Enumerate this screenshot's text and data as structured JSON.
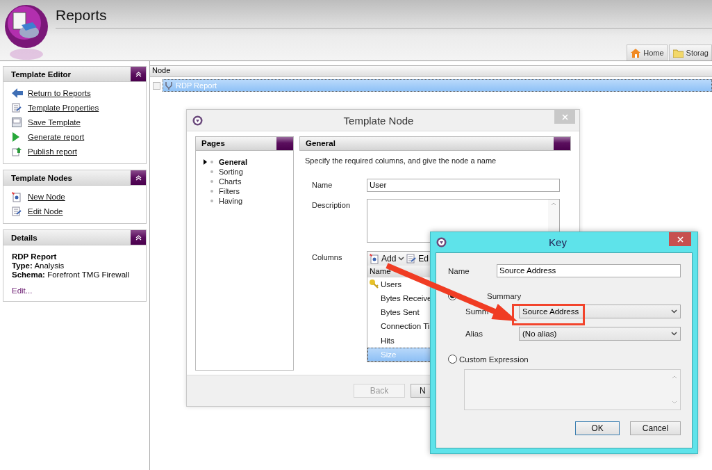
{
  "app": {
    "title": "Reports"
  },
  "nav_tabs": [
    {
      "label": "Home"
    },
    {
      "label": "Storag"
    }
  ],
  "sidebar": [
    {
      "title": "Template Editor",
      "kind": "links",
      "items": [
        {
          "label": "Return to Reports"
        },
        {
          "label": "Template Properties"
        },
        {
          "label": "Save Template"
        },
        {
          "label": "Generate report"
        },
        {
          "label": "Publish report"
        }
      ]
    },
    {
      "title": "Template Nodes",
      "kind": "links",
      "items": [
        {
          "label": "New Node"
        },
        {
          "label": "Edit Node"
        }
      ]
    },
    {
      "title": "Details",
      "kind": "details",
      "name": "RDP Report",
      "fields": [
        {
          "label": "Type:",
          "value": "Analysis"
        },
        {
          "label": "Schema:",
          "value": "Forefront TMG Firewall"
        }
      ],
      "link": "Edit..."
    }
  ],
  "tree": {
    "column": "Node",
    "rows": [
      {
        "label": "RDP Report",
        "selected": true
      }
    ]
  },
  "template_dialog": {
    "title": "Template Node",
    "pages": {
      "title": "Pages",
      "items": [
        {
          "label": "General",
          "selected": true
        },
        {
          "label": "Sorting",
          "selected": false
        },
        {
          "label": "Charts",
          "selected": false
        },
        {
          "label": "Filters",
          "selected": false
        },
        {
          "label": "Having",
          "selected": false
        }
      ]
    },
    "general": {
      "title": "General",
      "instructions": "Specify the required columns, and give the node a name",
      "name_label": "Name",
      "name_value": "User",
      "description_label": "Description",
      "columns_label": "Columns",
      "toolbar": [
        {
          "label": "Add",
          "dropdown": true
        },
        {
          "label": "Ed",
          "dropdown": false
        }
      ],
      "list_header": "Name",
      "columns": [
        {
          "label": "Users",
          "key": true,
          "selected": false
        },
        {
          "label": "Bytes Receive",
          "key": false,
          "selected": false
        },
        {
          "label": "Bytes Sent",
          "key": false,
          "selected": false
        },
        {
          "label": "Connection Ti",
          "key": false,
          "selected": false
        },
        {
          "label": "Hits",
          "key": false,
          "selected": false
        },
        {
          "label": "Size",
          "key": false,
          "selected": true
        }
      ]
    },
    "buttons": [
      {
        "label": "Back",
        "disabled": true
      },
      {
        "label": "N",
        "disabled": false
      }
    ]
  },
  "key_dialog": {
    "title": "Key",
    "name_label": "Name",
    "name_value": "Source Address",
    "options": [
      {
        "label": "Summary",
        "selected": true
      },
      {
        "label": "Custom Expression",
        "selected": false
      }
    ],
    "summary_label": "Summ",
    "summary_value": "Source Address",
    "alias_label": "Alias",
    "alias_value": "(No alias)",
    "buttons": [
      {
        "label": "OK",
        "default": true
      },
      {
        "label": "Cancel",
        "default": false
      }
    ]
  }
}
